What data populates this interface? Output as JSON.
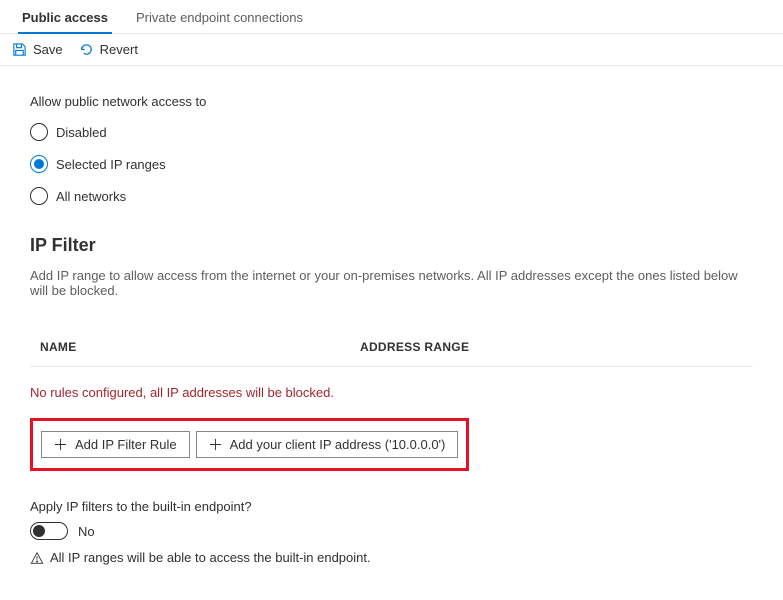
{
  "tabs": {
    "public_access": "Public access",
    "private_endpoint": "Private endpoint connections"
  },
  "toolbar": {
    "save": "Save",
    "revert": "Revert"
  },
  "access_section": {
    "label": "Allow public network access to",
    "options": {
      "disabled": "Disabled",
      "selected_ip": "Selected IP ranges",
      "all_networks": "All networks"
    }
  },
  "ip_filter": {
    "heading": "IP Filter",
    "description": "Add IP range to allow access from the internet or your on-premises networks. All IP addresses except the ones listed below will be blocked.",
    "columns": {
      "name": "NAME",
      "address_range": "ADDRESS RANGE"
    },
    "empty_warning": "No rules configured, all IP addresses will be blocked.",
    "add_rule_btn": "Add IP Filter Rule",
    "add_client_ip_btn": "Add your client IP address ('10.0.0.0')"
  },
  "apply_section": {
    "label": "Apply IP filters to the built-in endpoint?",
    "toggle_value": "No",
    "info_text": "All IP ranges will be able to access the built-in endpoint."
  }
}
